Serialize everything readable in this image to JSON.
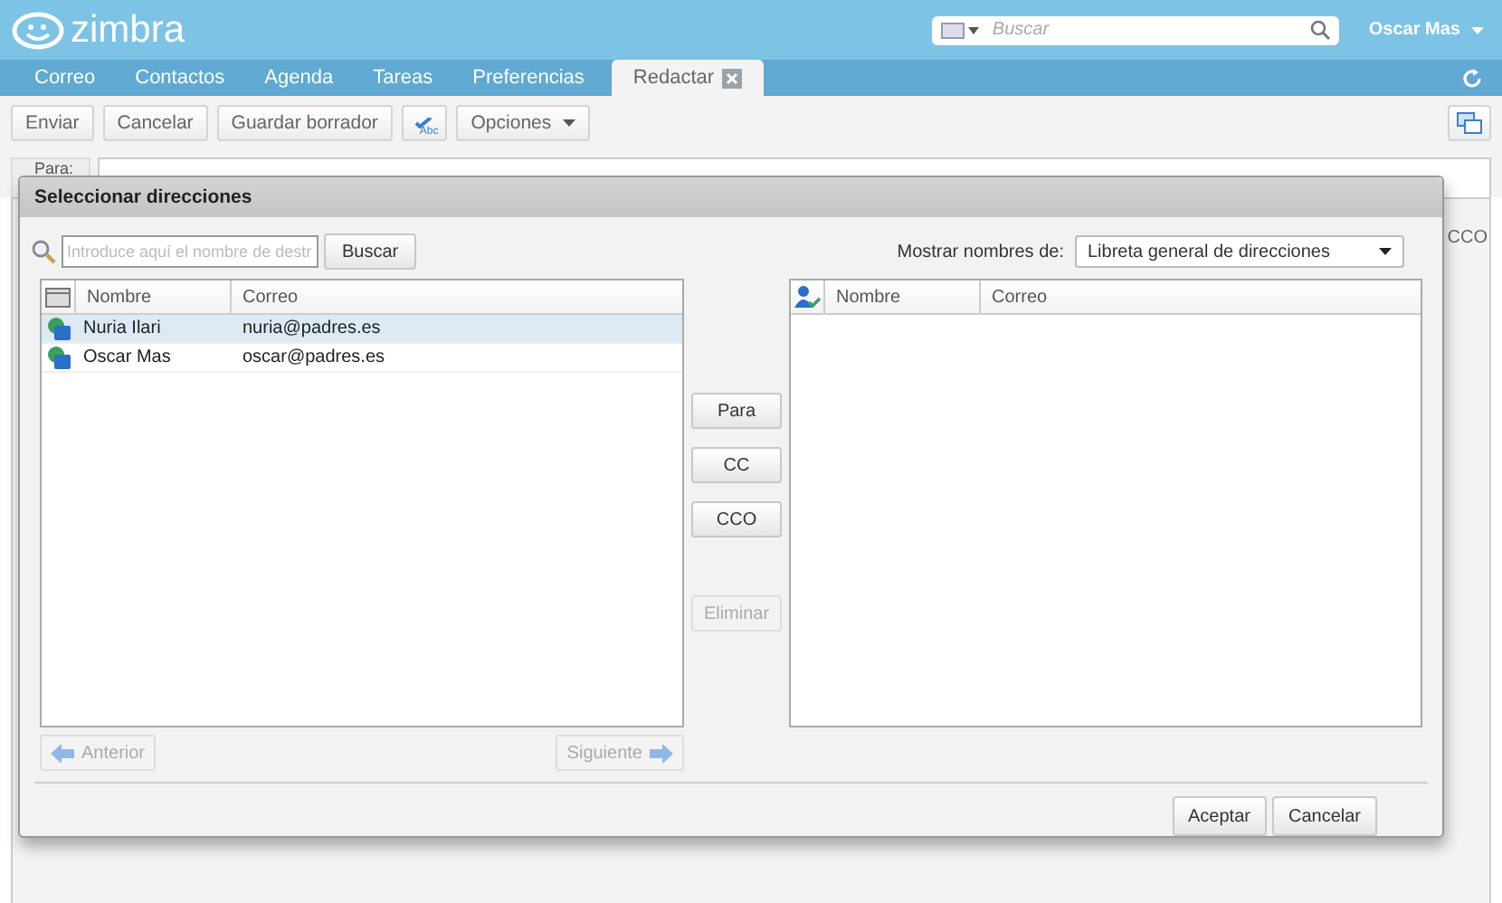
{
  "header": {
    "logo": "zimbra",
    "search": {
      "placeholder": "Buscar"
    },
    "user": "Oscar Mas"
  },
  "tabs": [
    {
      "label": "Correo",
      "selected": false,
      "kind": "app"
    },
    {
      "label": "Contactos",
      "selected": false,
      "kind": "app"
    },
    {
      "label": "Agenda",
      "selected": false,
      "kind": "app"
    },
    {
      "label": "Tareas",
      "selected": false,
      "kind": "app"
    },
    {
      "label": "Preferencias",
      "selected": false,
      "kind": "app"
    },
    {
      "label": "Redactar",
      "selected": true,
      "kind": "document"
    }
  ],
  "toolbar": {
    "buttons": [
      {
        "label": "Enviar",
        "kind": "text"
      },
      {
        "label": "Cancelar",
        "kind": "text"
      },
      {
        "label": "Guardar borrador",
        "kind": "text"
      },
      {
        "label": "Abc",
        "kind": "spellcheck"
      },
      {
        "label": "Opciones",
        "kind": "menu"
      }
    ]
  },
  "compose": {
    "to_label": "Para:",
    "bcc_label": "CCO"
  },
  "dialog": {
    "title": "Seleccionar direcciones",
    "search": {
      "placeholder": "Introduce aquí el nombre de destr",
      "button": "Buscar"
    },
    "source_label": "Mostrar nombres de:",
    "source": "Libreta general de direcciones",
    "results": {
      "columns": [
        "Nombre",
        "Correo"
      ],
      "rows": [
        {
          "name": "Nuria Ilari",
          "email": "nuria@padres.es",
          "selected": true
        },
        {
          "name": "Oscar Mas",
          "email": "oscar@padres.es",
          "selected": false
        }
      ]
    },
    "add_buttons": [
      {
        "label": "Para",
        "disabled": false
      },
      {
        "label": "CC",
        "disabled": false
      },
      {
        "label": "CCO",
        "disabled": false
      },
      {
        "label": "Eliminar",
        "disabled": true
      }
    ],
    "selected_list": {
      "columns": [
        "Nombre",
        "Correo"
      ]
    },
    "pager": {
      "previous": {
        "label": "Anterior",
        "disabled": true
      },
      "next": {
        "label": "Siguiente",
        "disabled": true
      }
    },
    "buttons": [
      "Aceptar",
      "Cancelar"
    ]
  }
}
